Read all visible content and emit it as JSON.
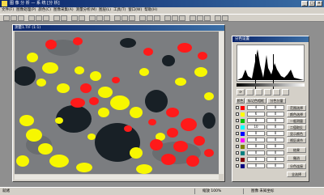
{
  "window": {
    "title": "图 像 分 析 — 系 统 [分 析]",
    "minimize_glyph": "_",
    "maximize_glyph": "□",
    "close_glyph": "×",
    "app_icon": "app-icon"
  },
  "menu": [
    "文件(F)",
    "图像处理(P)",
    "颜色(C)",
    "图像采集(A)",
    "测量分析(M)",
    "图层(L)",
    "工具(T)",
    "窗口(W)",
    "帮助(H)"
  ],
  "image_window": {
    "title": "测量1.TIF (1:1)"
  },
  "side_panel": {
    "title": "分色设置",
    "tabs": [
      "颜色",
      "标记色相框",
      "分色分量"
    ],
    "right_buttons": [
      "范围选择",
      "颜色选择",
      "一般测量",
      "二值取反",
      "显示颜色",
      "视区调节",
      "结果",
      "撤消",
      "分色连接",
      "全选择"
    ],
    "rows": [
      {
        "color": "#ff0000",
        "v1": "4",
        "v2": "0"
      },
      {
        "color": "#ffff00",
        "v1": "6",
        "v2": "0"
      },
      {
        "color": "#00c000",
        "v1": "8",
        "v2": "0"
      },
      {
        "color": "#00ffff",
        "v1": "10",
        "v2": "0"
      },
      {
        "color": "#0000ff",
        "v1": "0",
        "v2": "0"
      },
      {
        "color": "#ff00ff",
        "v1": "0",
        "v2": "0"
      },
      {
        "color": "#808000",
        "v1": "0",
        "v2": "0"
      },
      {
        "color": "#008080",
        "v1": "0",
        "v2": "0"
      },
      {
        "color": "#800000",
        "v1": "0",
        "v2": "0"
      },
      {
        "color": "#000080",
        "v1": "0",
        "v2": "0"
      }
    ]
  },
  "status": {
    "left": "就绪",
    "zoom": "缩放 100%",
    "coords": "图像 未知坐标"
  },
  "colors": {
    "title_blue": "#0a246a",
    "phase_red": "#ff1a1a",
    "phase_yellow": "#f7f700",
    "matrix_gray": "#7b7d80",
    "pore_dark": "#182026"
  }
}
